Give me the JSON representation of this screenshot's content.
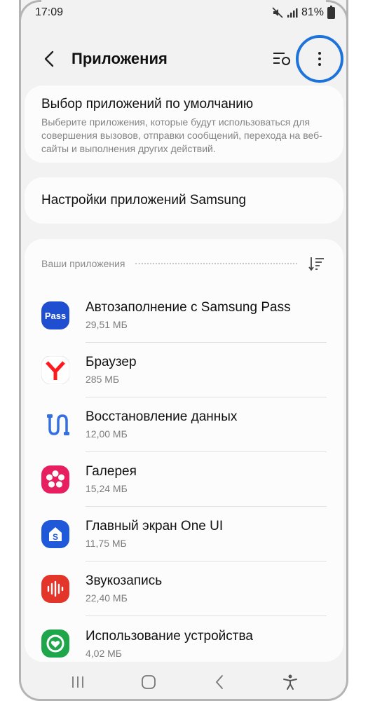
{
  "status": {
    "time": "17:09",
    "battery": "81%"
  },
  "header": {
    "title": "Приложения"
  },
  "default_apps": {
    "title": "Выбор приложений по умолчанию",
    "subtitle": "Выберите приложения, которые будут использоваться для совершения вызовов, отправки сообщений, перехода на веб-сайты и выполнения других действий."
  },
  "samsung_settings": {
    "label": "Настройки приложений Samsung"
  },
  "apps": {
    "header": "Ваши приложения",
    "items": [
      {
        "name": "Автозаполнение с Samsung Pass",
        "size": "29,51 МБ",
        "icon": "samsung-pass-icon",
        "color": "#1f4fd0"
      },
      {
        "name": "Браузер",
        "size": "285 МБ",
        "icon": "yandex-browser-icon",
        "color": "#fc1a1f"
      },
      {
        "name": "Восстановление данных",
        "size": "12,00 МБ",
        "icon": "data-restore-icon",
        "color": "#3470e4"
      },
      {
        "name": "Галерея",
        "size": "15,24 МБ",
        "icon": "gallery-icon",
        "color": "#e71e5f"
      },
      {
        "name": "Главный экран One UI",
        "size": "11,75 МБ",
        "icon": "one-ui-home-icon",
        "color": "#1f58d8"
      },
      {
        "name": "Звукозапись",
        "size": "22,40 МБ",
        "icon": "voice-recorder-icon",
        "color": "#e3352a"
      },
      {
        "name": "Использование устройства",
        "size": "4,02 МБ",
        "icon": "device-care-icon",
        "color": "#20a64a"
      }
    ]
  },
  "accent": "#1e73d9"
}
